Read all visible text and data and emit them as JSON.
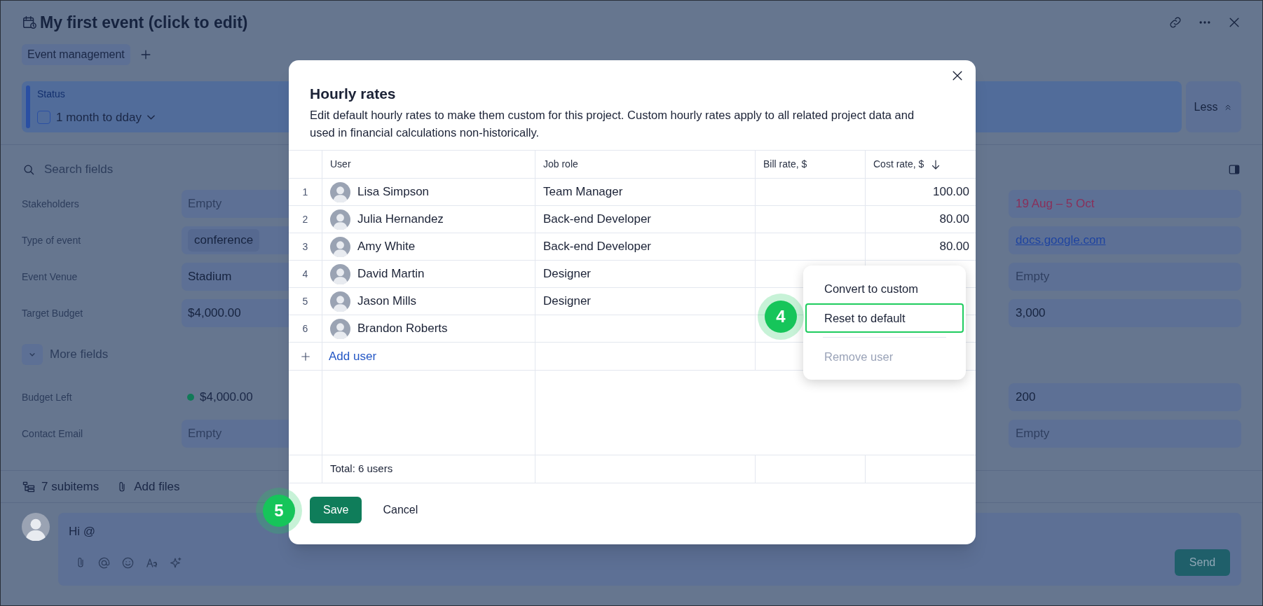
{
  "page": {
    "title": "My first event (click to edit)",
    "tags": [
      "Event management"
    ],
    "status": {
      "label": "Status",
      "value": "1 month to dday",
      "checked": false
    },
    "less_button": "Less",
    "search": {
      "placeholder": "Search fields"
    },
    "fields": [
      {
        "label": "Stakeholders",
        "value": "Empty",
        "kind": "empty",
        "right": {
          "value": "19 Aug – 5 Oct",
          "kind": "date"
        }
      },
      {
        "label": "Type of event",
        "value": "conference",
        "kind": "tag",
        "right": {
          "value": "docs.google.com",
          "kind": "link"
        }
      },
      {
        "label": "Event Venue",
        "value": "Stadium",
        "kind": "text",
        "right": {
          "value": "Empty",
          "kind": "empty"
        }
      },
      {
        "label": "Target Budget",
        "value": "$4,000.00",
        "kind": "text",
        "right": {
          "value": "3,000",
          "kind": "text"
        }
      }
    ],
    "more_fields": "More fields",
    "more_fields_list": [
      {
        "label": "Budget Left",
        "value": "$4,000.00",
        "kind": "dot",
        "color": "#117a58",
        "right": {
          "value": "200",
          "kind": "text"
        }
      },
      {
        "label": "Contact Email",
        "value": "Empty",
        "kind": "empty",
        "right": {
          "value": "Empty",
          "kind": "empty"
        }
      }
    ],
    "subitems": "7 subitems",
    "add_files": "Add files",
    "comment": {
      "value": "Hi @"
    },
    "send": "Send"
  },
  "modal": {
    "title": "Hourly rates",
    "description": "Edit default hourly rates to make them custom for this project. Custom hourly rates apply to all related project data and used in financial calculations non-historically.",
    "columns": [
      {
        "label": "User",
        "sorted": false
      },
      {
        "label": "Job role",
        "sorted": false
      },
      {
        "label": "Bill rate, $",
        "sorted": false
      },
      {
        "label": "Cost rate, $",
        "sorted": true
      }
    ],
    "rows": [
      {
        "index": "1",
        "user": "Lisa Simpson",
        "job_role": "Team Manager",
        "cost_rate": "100.00"
      },
      {
        "index": "2",
        "user": "Julia Hernandez",
        "job_role": "Back-end Developer",
        "cost_rate": "80.00"
      },
      {
        "index": "3",
        "user": "Amy White",
        "job_role": "Back-end Developer",
        "cost_rate": "80.00"
      },
      {
        "index": "4",
        "user": "David Martin",
        "job_role": "Designer"
      },
      {
        "index": "5",
        "user": "Jason Mills",
        "job_role": "Designer"
      },
      {
        "index": "6",
        "user": "Brandon Roberts"
      }
    ],
    "add_user": "Add user",
    "total": "Total: 6 users",
    "buttons": [
      {
        "label": "Save",
        "kind": "primary"
      },
      {
        "label": "Cancel",
        "kind": "plain"
      }
    ],
    "context_menu": [
      {
        "label": "Convert to custom",
        "selected": false,
        "disabled": false
      },
      {
        "label": "Reset to default",
        "selected": true,
        "disabled": false
      },
      {
        "label": "Remove user",
        "selected": false,
        "disabled": true
      }
    ],
    "step_badges": [
      "4",
      "5"
    ]
  }
}
